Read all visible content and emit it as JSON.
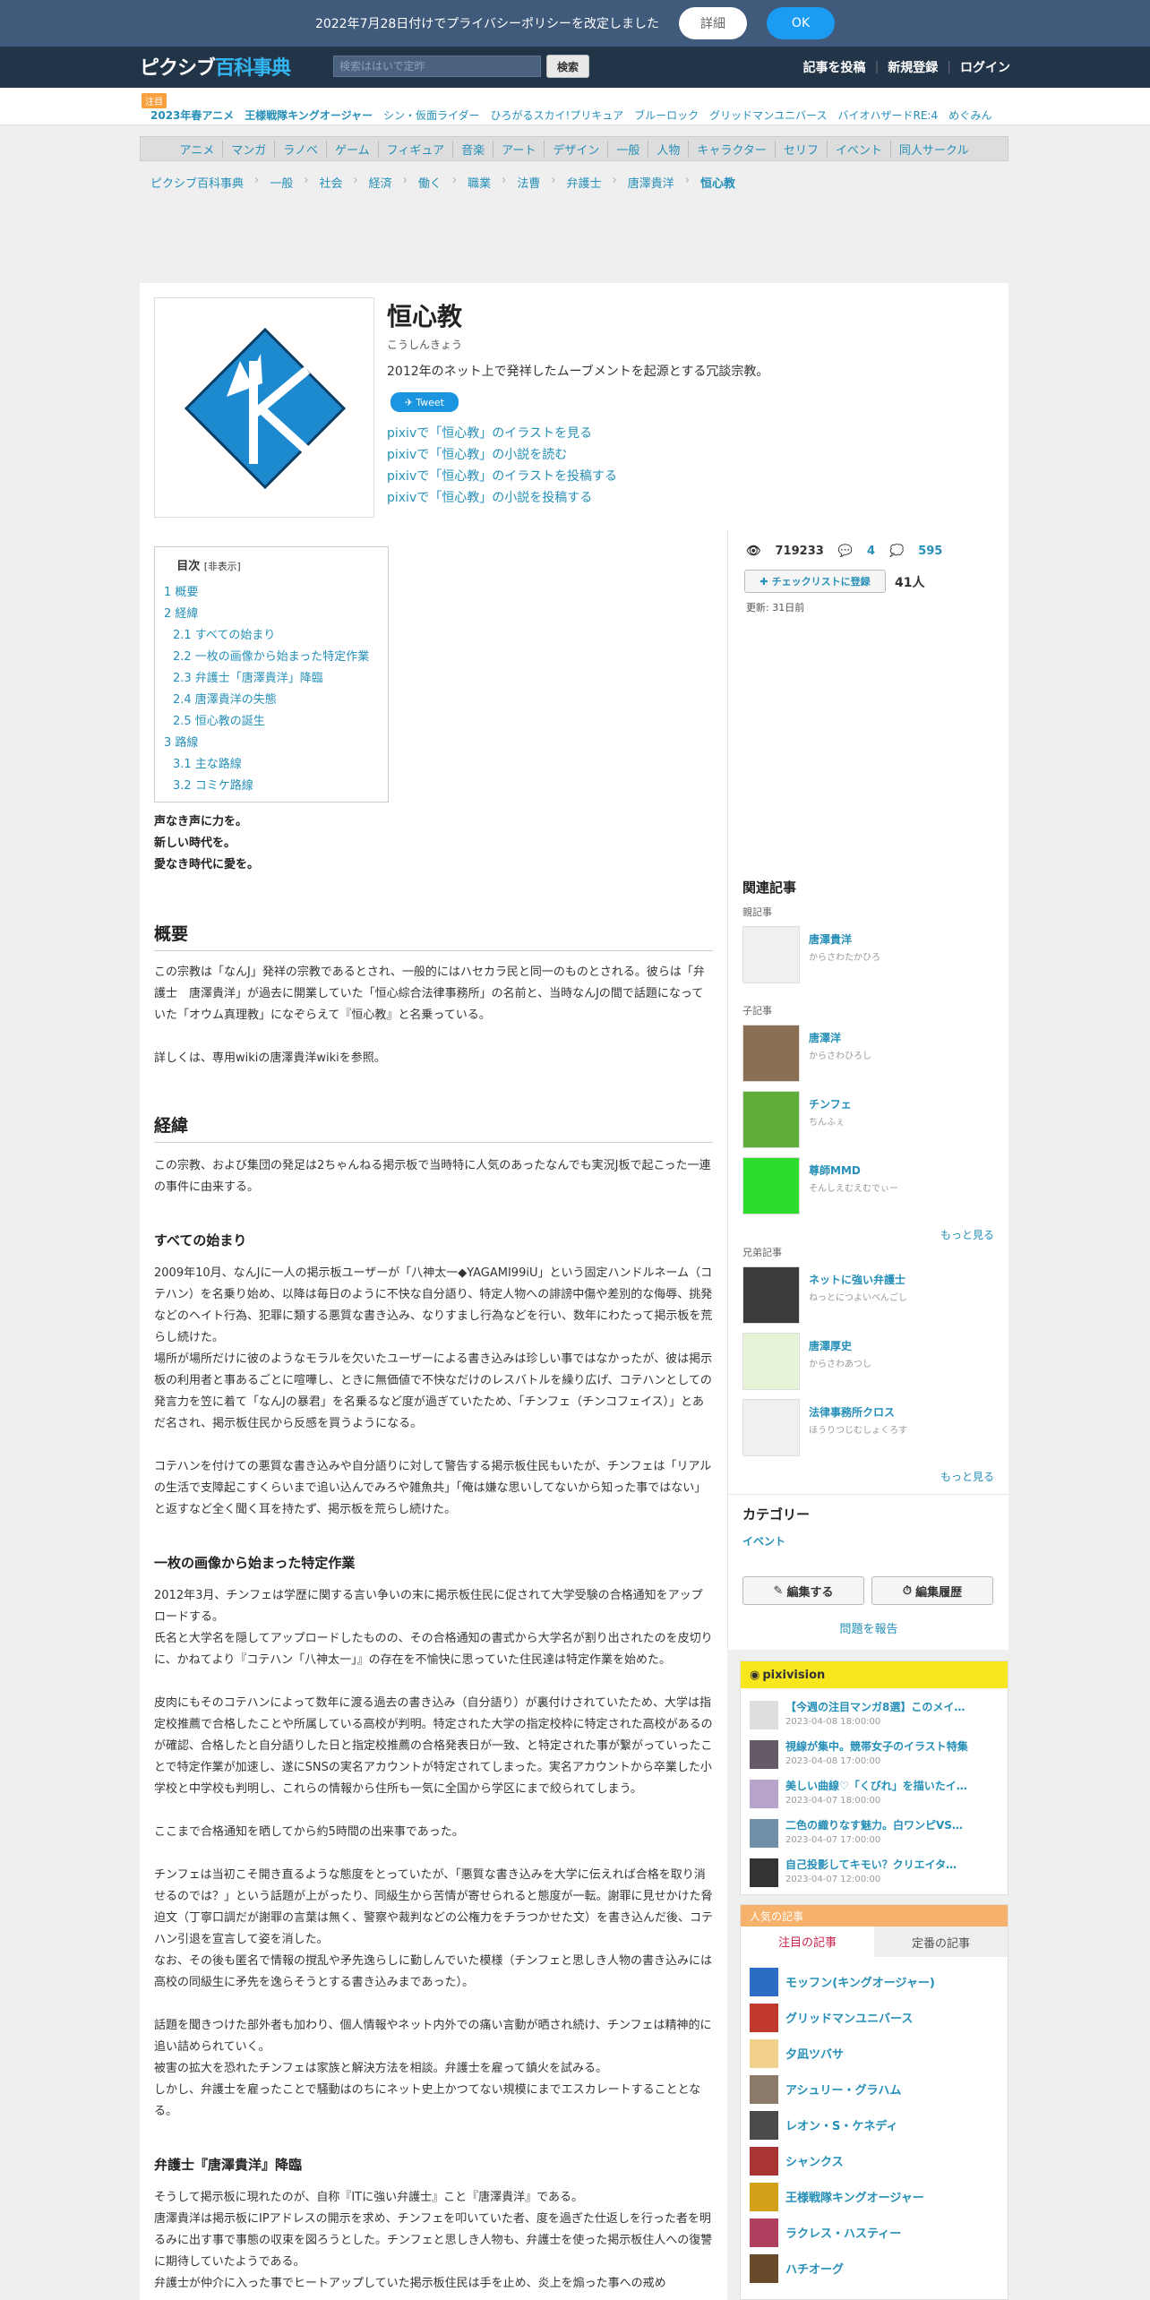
{
  "privacy": {
    "message": "2022年7月28日付けでプライバシーポリシーを改定しました",
    "detail_label": "詳細",
    "ok_label": "OK"
  },
  "header": {
    "logo_part1": "ピクシブ",
    "logo_part2": "百科事典",
    "search_placeholder": "検索ははいで定昨",
    "search_button": "検索",
    "nav": [
      "記事を投稿",
      "新規登録",
      "ログイン"
    ]
  },
  "trend": {
    "badge": "注目",
    "items": [
      "2023年春アニメ",
      "王様戦隊キングオージャー",
      "シン・仮面ライダー",
      "ひろがるスカイ!プリキュア",
      "ブルーロック",
      "グリッドマンユニバース",
      "バイオハザードRE:4",
      "めぐみん"
    ]
  },
  "categories": [
    "アニメ",
    "マンガ",
    "ラノベ",
    "ゲーム",
    "フィギュア",
    "音楽",
    "アート",
    "デザイン",
    "一般",
    "人物",
    "キャラクター",
    "セリフ",
    "イベント",
    "同人サークル"
  ],
  "breadcrumb": [
    "ピクシブ百科事典",
    "一般",
    "社会",
    "経済",
    "働く",
    "職業",
    "法曹",
    "弁護士",
    "唐澤貴洋",
    "恒心教"
  ],
  "article": {
    "title": "恒心教",
    "reading": "こうしんきょう",
    "summary": "2012年のネット上で発祥したムーブメントを起源とする冗談宗教。",
    "tweet_label": "Tweet",
    "pixiv_links": [
      "pixivで「恒心教」のイラストを見る",
      "pixivで「恒心教」の小説を読む",
      "pixivで「恒心教」のイラストを投稿する",
      "pixivで「恒心教」の小説を投稿する"
    ]
  },
  "toc": {
    "title": "目次",
    "toggle": "[非表示]",
    "items": [
      {
        "label": "1 概要",
        "sub": false
      },
      {
        "label": "2 経緯",
        "sub": false
      },
      {
        "label": "2.1 すべての始まり",
        "sub": true
      },
      {
        "label": "2.2 一枚の画像から始まった特定作業",
        "sub": true
      },
      {
        "label": "2.3 弁護士「唐澤貴洋」降臨",
        "sub": true
      },
      {
        "label": "2.4 唐澤貴洋の失態",
        "sub": true
      },
      {
        "label": "2.5 恒心教の誕生",
        "sub": true
      },
      {
        "label": "3 路線",
        "sub": false
      },
      {
        "label": "3.1 主な路線",
        "sub": true
      },
      {
        "label": "3.2 コミケ路線",
        "sub": true
      }
    ]
  },
  "body": {
    "quote": [
      "声なき声に力を。",
      "新しい時代を。",
      "愛なき時代に愛を。"
    ],
    "h_overview": "概要",
    "overview_p1": "この宗教は「なんJ」発祥の宗教であるとされ、一般的にはハセカラ民と同一のものとされる。彼らは「弁護士　唐澤貴洋」が過去に開業していた「恒心綜合法律事務所」の名前と、当時なんJの間で話題になっていた「オウム真理教」になぞらえて『恒心教』と名乗っている。",
    "overview_p2": "詳しくは、専用wikiの唐澤貴洋wikiを参照。",
    "h_history": "経緯",
    "history_p1": "この宗教、および集団の発足は2ちゃんねる掲示板で当時特に人気のあったなんでも実況J板で起こった一連の事件に由来する。",
    "h_start": "すべての始まり",
    "start_p1": "2009年10月、なんJに一人の掲示板ユーザーが「八神太一◆YAGAMI99iU」という固定ハンドルネーム（コテハン）を名乗り始め、以降は毎日のように不快な自分語り、特定人物への誹謗中傷や差別的な侮辱、挑発などのヘイト行為、犯罪に類する悪質な書き込み、なりすまし行為などを行い、数年にわたって掲示板を荒らし続けた。",
    "start_p2": "場所が場所だけに彼のようなモラルを欠いたユーザーによる書き込みは珍しい事ではなかったが、彼は掲示板の利用者と事あるごとに喧嘩し、ときに無価値で不快なだけのレスバトルを繰り広げ、コテハンとしての発言力を笠に着て「なんJの暴君」を名乗るなど度が過ぎていたため、「チンフェ（チンコフェイス）」とあだ名され、掲示板住民から反感を買うようになる。",
    "start_p3": "コテハンを付けての悪質な書き込みや自分語りに対して警告する掲示板住民もいたが、チンフェは「リアルの生活で支障起こすくらいまで追い込んでみろや雑魚共」「俺は嫌な思いしてないから知った事ではない」と返すなど全く聞く耳を持たず、掲示板を荒らし続けた。",
    "h_image": "一枚の画像から始まった特定作業",
    "image_p1": "2012年3月、チンフェは学歴に関する言い争いの末に掲示板住民に促されて大学受験の合格通知をアップロードする。",
    "image_p2": "氏名と大学名を隠してアップロードしたものの、その合格通知の書式から大学名が割り出されたのを皮切りに、かねてより『コテハン「八神太一」』の存在を不愉快に思っていた住民達は特定作業を始めた。",
    "image_p3": "皮肉にもそのコテハンによって数年に渡る過去の書き込み（自分語り）が裏付けされていたため、大学は指定校推薦で合格したことや所属している高校が判明。特定された大学の指定校枠に特定された高校があるのが確認、合格したと自分語りした日と指定校推薦の合格発表日が一致、と特定された事が繋がっていったことで特定作業が加速し、遂にSNSの実名アカウントが特定されてしまった。実名アカウントから卒業した小学校と中学校も判明し、これらの情報から住所も一気に全国から学区にまで絞られてしまう。",
    "image_p4": "ここまで合格通知を晒してから約5時間の出来事であった。",
    "image_p5": "チンフェは当初こそ開き直るような態度をとっていたが、「悪質な書き込みを大学に伝えれば合格を取り消せるのでは？」という話題が上がったり、同級生から苦情が寄せられると態度が一転。謝罪に見せかけた脅迫文（丁寧口調だが謝罪の言葉は無く、警察や裁判などの公権力をチラつかせた文）を書き込んだ後、コテハン引退を宣言して姿を消した。",
    "image_p6": "なお、その後も匿名で情報の撹乱や矛先逸らしに勤しんでいた模様（チンフェと思しき人物の書き込みには高校の同級生に矛先を逸らそうとする書き込みまであった）。",
    "image_p7": "話題を聞きつけた部外者も加わり、個人情報やネット内外での痛い言動が晒され続け、チンフェは精神的に追い詰められていく。",
    "image_p8": "被害の拡大を恐れたチンフェは家族と解決方法を相談。弁護士を雇って鎮火を試みる。",
    "image_p9": "しかし、弁護士を雇ったことで騒動はのちにネット史上かつてない規模にまでエスカレートすることとなる。",
    "h_lawyer": "弁護士『唐澤貴洋』降臨",
    "lawyer_p1": "そうして掲示板に現れたのが、自称『ITに強い弁護士』こと『唐澤貴洋』である。",
    "lawyer_p2": "唐澤貴洋は掲示板にIPアドレスの開示を求め、チンフェを叩いていた者、度を過ぎた仕返しを行った者を明るみに出す事で事態の収束を図ろうとした。チンフェと思しき人物も、弁護士を使った掲示板住人への復讐に期待していたようである。",
    "lawyer_p3": "弁護士が仲介に入った事でヒートアップしていた掲示板住民は手を止め、炎上を煽った事への戒め"
  },
  "stats": {
    "views": "719233",
    "comments": "4",
    "likes": "595",
    "checklist_label": "チェックリストに登録",
    "checklist_count": "41人",
    "updated": "更新: 31日前"
  },
  "related": {
    "title": "関連記事",
    "parent_label": "親記事",
    "parent": {
      "name": "唐澤貴洋",
      "kana": "からさわたかひろ"
    },
    "child_label": "子記事",
    "children": [
      {
        "name": "唐澤洋",
        "kana": "からさわひろし"
      },
      {
        "name": "チンフェ",
        "kana": "ちんふぇ"
      },
      {
        "name": "尊師MMD",
        "kana": "そんしえむえむでぃー"
      }
    ],
    "more": "もっと見る",
    "sibling_label": "兄弟記事",
    "siblings": [
      {
        "name": "ネットに強い弁護士",
        "kana": "ねっとにつよいべんごし"
      },
      {
        "name": "唐澤厚史",
        "kana": "からさわあつし"
      },
      {
        "name": "法律事務所クロス",
        "kana": "ほうりつじむしょくろす"
      }
    ],
    "category_title": "カテゴリー",
    "category": "イベント",
    "edit_label": "編集する",
    "history_label": "編集履歴",
    "report_label": "問題を報告"
  },
  "pixivision": {
    "title": "pixivision",
    "items": [
      {
        "title": "【今週の注目マンガ8選】このメイ…",
        "date": "2023-04-08 18:00:00"
      },
      {
        "title": "視線が集中。競帯女子のイラスト特集",
        "date": "2023-04-08 17:00:00"
      },
      {
        "title": "美しい曲線♡「くびれ」を描いたイ…",
        "date": "2023-04-07 18:00:00"
      },
      {
        "title": "二色の織りなす魅力。白ワンピVS…",
        "date": "2023-04-07 17:00:00"
      },
      {
        "title": "自己投影してキモい？クリエイタ…",
        "date": "2023-04-07 12:00:00"
      }
    ]
  },
  "popular": {
    "title": "人気の記事",
    "tab_active": "注目の記事",
    "tab_inactive": "定番の記事",
    "items": [
      "モッフン(キングオージャー)",
      "グリッドマンユニバース",
      "夕凪ツバサ",
      "アシュリー・グラハム",
      "レオン・S・ケネディ",
      "シャンクス",
      "王様戦隊キングオージャー",
      "ラクレス・ハスティー",
      "ハチオーグ"
    ]
  }
}
